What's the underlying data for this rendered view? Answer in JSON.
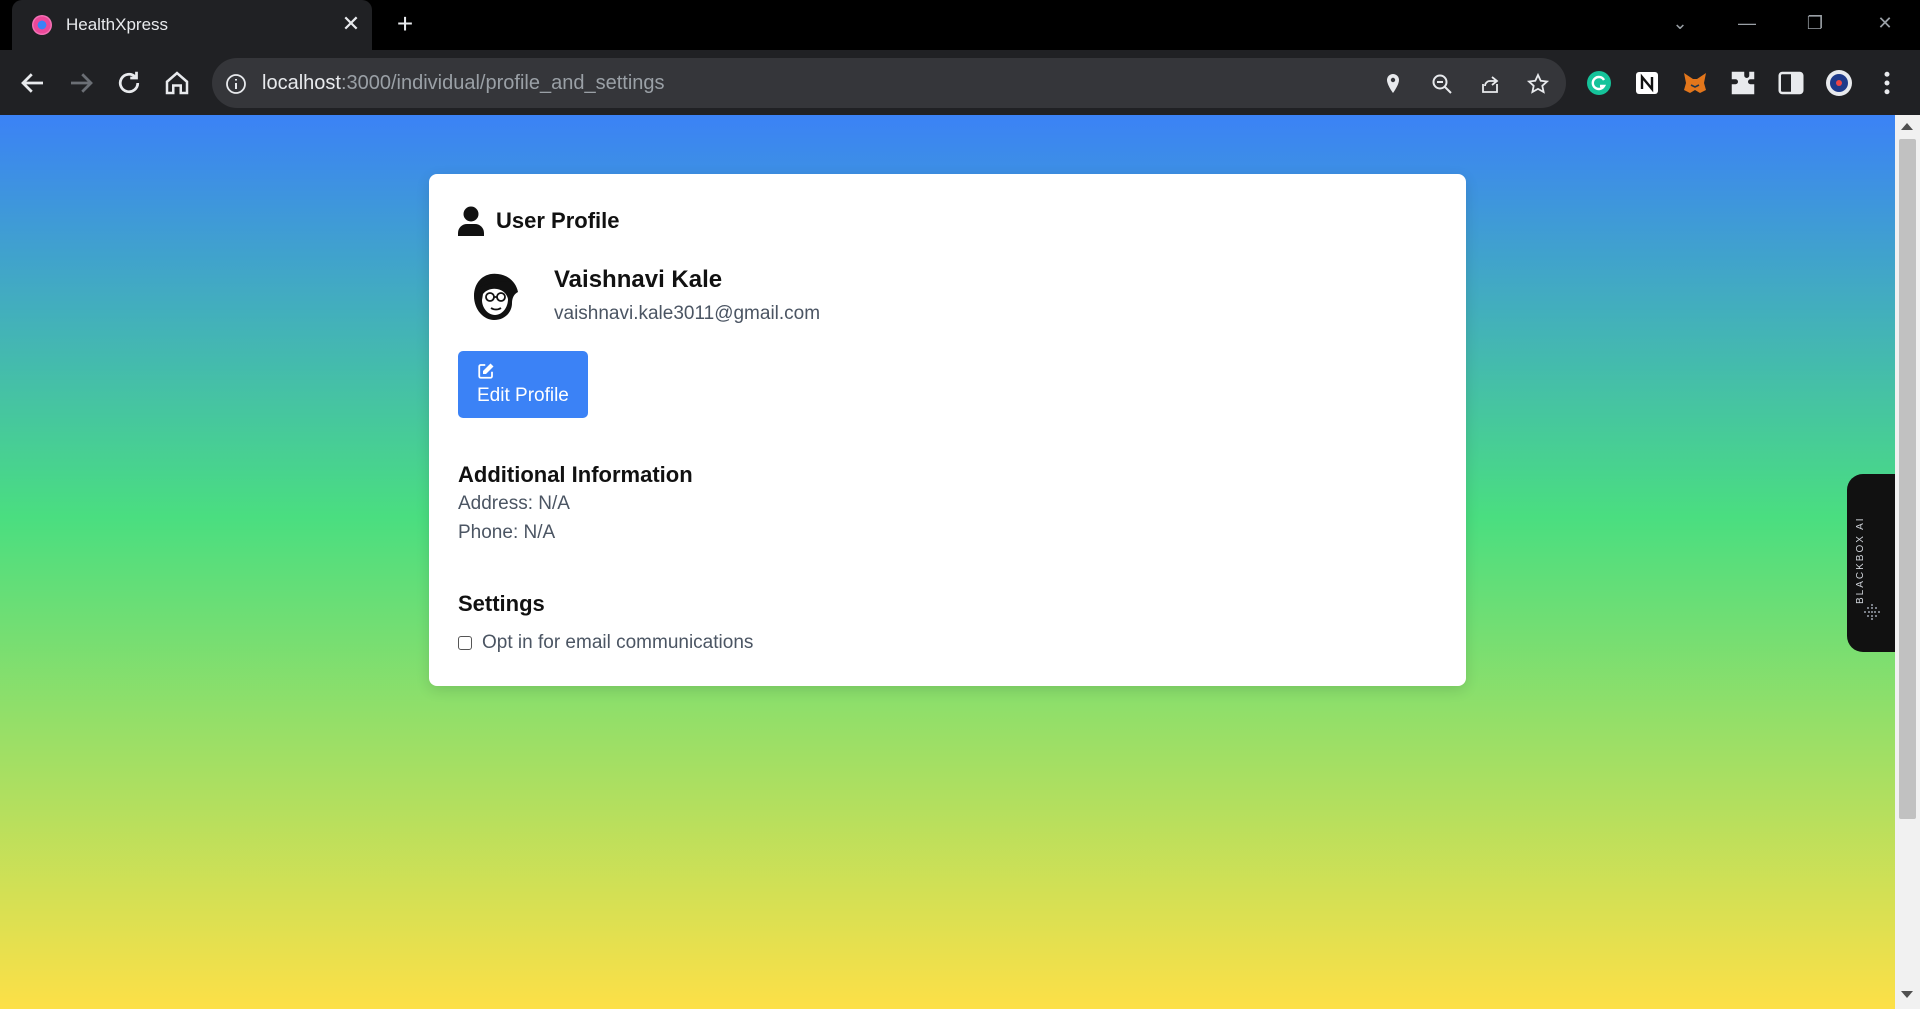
{
  "browser": {
    "tab_title": "HealthXpress",
    "url_host": "localhost",
    "url_path": ":3000/individual/profile_and_settings"
  },
  "profile": {
    "section_title": "User Profile",
    "name": "Vaishnavi Kale",
    "email": "vaishnavi.kale3011@gmail.com",
    "edit_label": "Edit Profile"
  },
  "additional": {
    "heading": "Additional Information",
    "address": "Address: N/A",
    "phone": "Phone: N/A"
  },
  "settings": {
    "heading": "Settings",
    "email_opt_label": "Opt in for email communications",
    "email_opt_checked": false
  },
  "sidebar_widget": {
    "label": "BLACKBOX AI"
  },
  "colors": {
    "accent": "#3b82f6",
    "gradient_top": "#3b82f6",
    "gradient_mid": "#4ade80",
    "gradient_bottom": "#fde047"
  }
}
